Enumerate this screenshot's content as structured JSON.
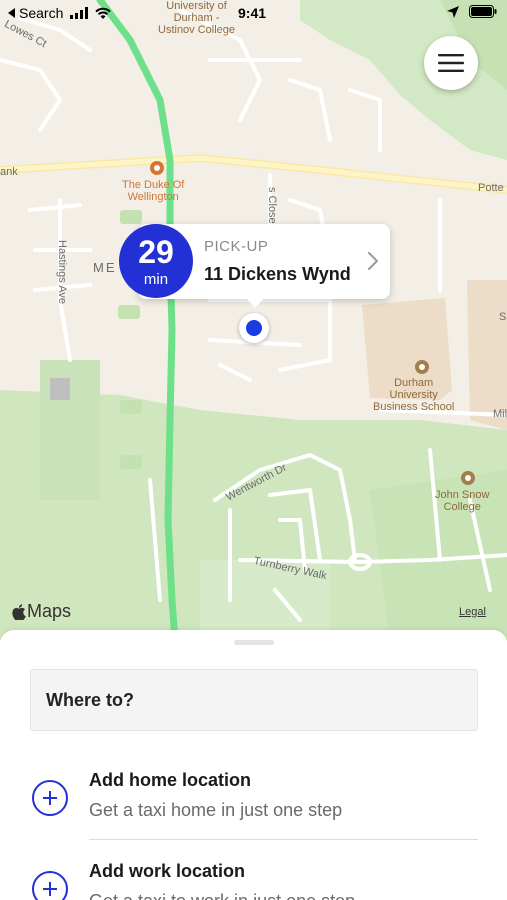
{
  "status_bar": {
    "back_label": "Search",
    "time": "9:41"
  },
  "map": {
    "labels": {
      "university": "University of Durham - Ustinov College",
      "university_line1": "University of",
      "university_line2": "Durham -",
      "university_line3": "Ustinov College",
      "lowes_ct": "Lowes Ct",
      "bank": "ank",
      "duke_line1": "The Duke Of",
      "duke_line2": "Wellington",
      "potters": "Potte",
      "hastings": "Hastings Ave",
      "me": "ME",
      "close": "s Close",
      "business_line1": "Durham",
      "business_line2": "University",
      "business_line3": "Business School",
      "mill": "Mil",
      "s_edge": "S",
      "wentworth": "Wentworth Dr",
      "turnberry": "Turnberry Walk",
      "john_snow_line1": "John Snow",
      "john_snow_line2": "College"
    },
    "maps_brand": "Maps",
    "legal": "Legal",
    "icons": {
      "pin": "pin-icon",
      "menu": "hamburger-menu-icon"
    },
    "colors": {
      "route": "#6ee089",
      "park": "#cfe6bf",
      "accent": "#2230d6"
    }
  },
  "pickup": {
    "eta_value": "29",
    "eta_unit": "min",
    "label": "PICK-UP",
    "address": "11 Dickens Wynd"
  },
  "sheet": {
    "search_placeholder": "Where to?",
    "shortcuts": [
      {
        "title": "Add home location",
        "subtitle": "Get a taxi home in just one step"
      },
      {
        "title": "Add work location",
        "subtitle": "Get a taxi to work in just one step"
      }
    ]
  }
}
